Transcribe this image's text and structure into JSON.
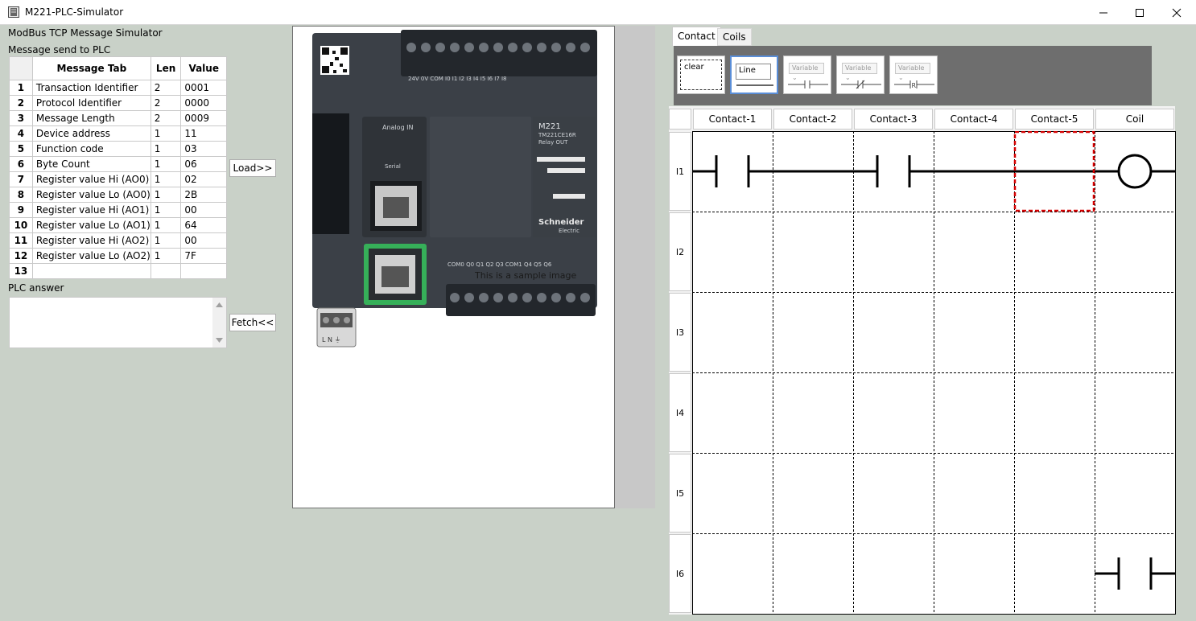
{
  "window": {
    "title": "M221-PLC-Simulator"
  },
  "left": {
    "section_title": "ModBus TCP Message Simulator",
    "send_label": "Message send to PLC",
    "table": {
      "headers": [
        "Message Tab",
        "Len",
        "Value"
      ],
      "rows": [
        {
          "idx": "1",
          "tab": "Transaction Identifier",
          "len": "2",
          "value": "0001"
        },
        {
          "idx": "2",
          "tab": "Protocol Identifier",
          "len": "2",
          "value": "0000"
        },
        {
          "idx": "3",
          "tab": "Message Length",
          "len": "2",
          "value": "0009"
        },
        {
          "idx": "4",
          "tab": "Device address",
          "len": "1",
          "value": "11"
        },
        {
          "idx": "5",
          "tab": "Function code",
          "len": "1",
          "value": "03"
        },
        {
          "idx": "6",
          "tab": "Byte Count",
          "len": "1",
          "value": "06"
        },
        {
          "idx": "7",
          "tab": "Register value Hi (AO0)",
          "len": "1",
          "value": "02"
        },
        {
          "idx": "8",
          "tab": "Register value Lo (AO0)",
          "len": "1",
          "value": "2B"
        },
        {
          "idx": "9",
          "tab": "Register value Hi (AO1)",
          "len": "1",
          "value": "00"
        },
        {
          "idx": "10",
          "tab": "Register value Lo (AO1)",
          "len": "1",
          "value": "64"
        },
        {
          "idx": "11",
          "tab": "Register value Hi (AO2)",
          "len": "1",
          "value": "00"
        },
        {
          "idx": "12",
          "tab": "Register value Lo (AO2)",
          "len": "1",
          "value": "7F"
        },
        {
          "idx": "13",
          "tab": "",
          "len": "",
          "value": ""
        }
      ]
    },
    "load_button": "Load>>",
    "answer_label": "PLC answer",
    "answer_value": "",
    "fetch_button": "Fetch<<"
  },
  "image_panel": {
    "overlay_text": "This is a sample image",
    "plc_model": "M221",
    "plc_ref": "TM221CE16R",
    "plc_out": "Relay OUT",
    "brand": "Schneider",
    "brand_sub": "Electric",
    "analog_label": "Analog IN",
    "serial_label": "Serial",
    "top_terminals": "24V  0V  COM  I0   I1   I2   I3   I4   I5   I6   I7   I8",
    "bottom_terminals": "COM0 Q0  Q1  Q2  Q3 COM1 Q4  Q5  Q6",
    "power_terminals": "L   N   ⏚"
  },
  "ladder": {
    "tabs": [
      "Contact",
      "Coils"
    ],
    "active_tab": "Contact",
    "tools": [
      {
        "label": "clear"
      },
      {
        "label": "Line"
      },
      {
        "label": "Variable"
      },
      {
        "label": "Variable"
      },
      {
        "label": "Variable"
      }
    ],
    "columns": [
      "Contact-1",
      "Contact-2",
      "Contact-3",
      "Contact-4",
      "Contact-5",
      "Coil"
    ],
    "rows": [
      "I1",
      "I2",
      "I3",
      "I4",
      "I5",
      "I6"
    ],
    "selected_cell": {
      "row": "I1",
      "column": "Contact-5"
    }
  },
  "colors": {
    "background": "#c9d1c8",
    "selection": "#d40000",
    "toolbox": "#6e6e6e"
  }
}
